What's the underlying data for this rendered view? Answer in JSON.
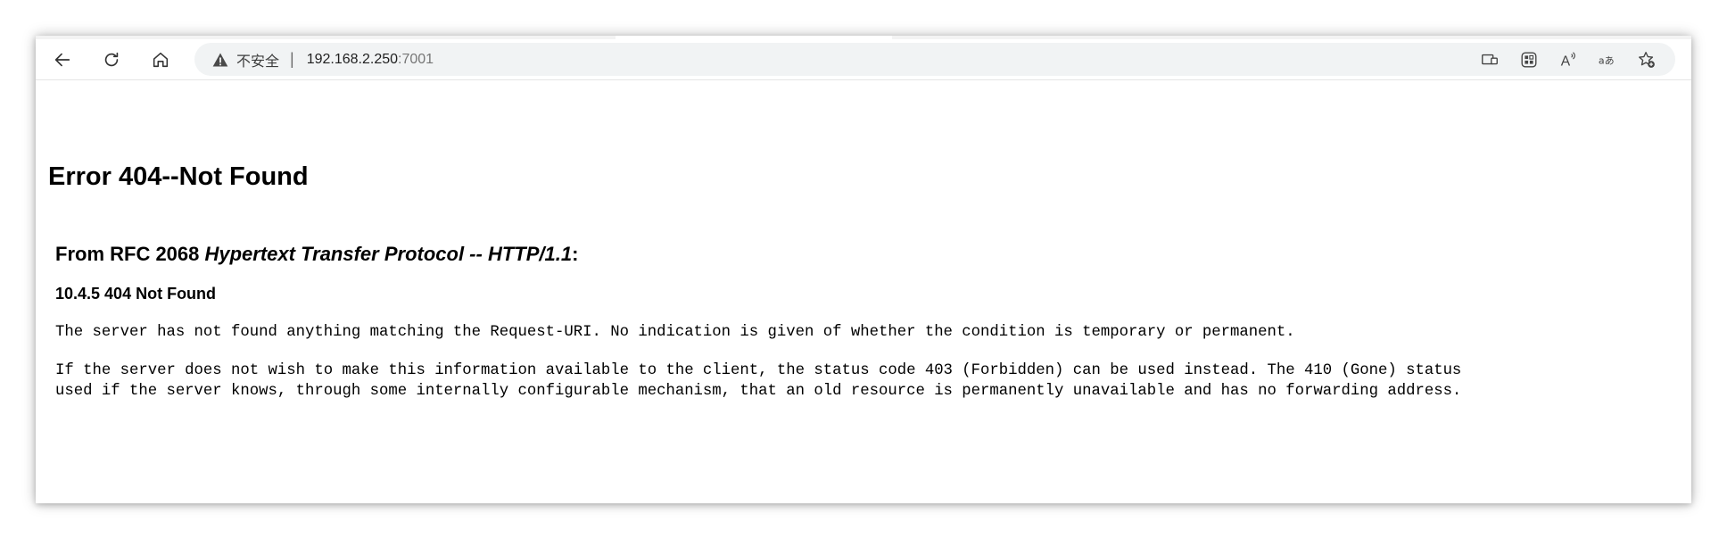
{
  "browser": {
    "security_label": "不安全",
    "separator": "|",
    "url_host": "192.168.2.250",
    "url_port": ":7001",
    "icons": {
      "back": "back-arrow-icon",
      "reload": "reload-icon",
      "home": "home-icon",
      "warning": "warning-triangle-icon",
      "right": [
        "immersive-reader-icon",
        "apps-icon",
        "read-aloud-icon",
        "translate-icon",
        "add-favorite-icon"
      ]
    },
    "right_icon_glyphs": {
      "read_aloud": "A",
      "translate": "aあ"
    }
  },
  "page": {
    "title": "Error 404--Not Found",
    "rfc_prefix": "From RFC 2068 ",
    "rfc_italic": "Hypertext Transfer Protocol -- HTTP/1.1",
    "rfc_suffix": ":",
    "section_title": "10.4.5 404 Not Found",
    "paragraph1": "The server has not found anything matching the Request-URI. No indication is given of whether the condition is temporary or permanent.",
    "paragraph2_line1": "If the server does not wish to make this information available to the client, the status code 403 (Forbidden) can be used instead. The 410 (Gone) status",
    "paragraph2_line2": "used if the server knows, through some internally configurable mechanism, that an old resource is permanently unavailable and has no forwarding address."
  }
}
